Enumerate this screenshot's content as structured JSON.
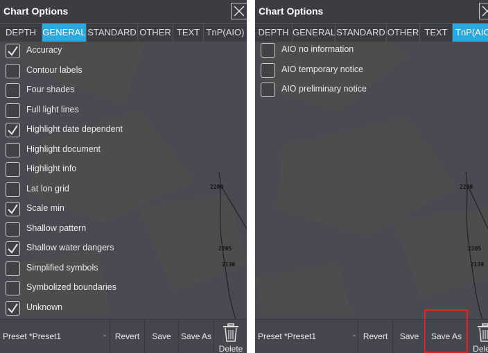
{
  "left_panel": {
    "title": "Chart Options",
    "tabs": [
      "DEPTH",
      "GENERAL",
      "STANDARD",
      "OTHER",
      "TEXT",
      "TnP(AIO)"
    ],
    "active_tab": "GENERAL",
    "items": [
      {
        "label": "Accuracy",
        "checked": true
      },
      {
        "label": "Contour labels",
        "checked": false
      },
      {
        "label": "Four shades",
        "checked": false
      },
      {
        "label": "Full light lines",
        "checked": false
      },
      {
        "label": "Highlight date dependent",
        "checked": true
      },
      {
        "label": "Highlight document",
        "checked": false
      },
      {
        "label": "Highlight info",
        "checked": false
      },
      {
        "label": "Lat lon grid",
        "checked": false
      },
      {
        "label": "Scale min",
        "checked": true
      },
      {
        "label": "Shallow pattern",
        "checked": false
      },
      {
        "label": "Shallow water dangers",
        "checked": true
      },
      {
        "label": "Simplified symbols",
        "checked": false
      },
      {
        "label": "Symbolized boundaries",
        "checked": false
      },
      {
        "label": "Unknown",
        "checked": true
      }
    ],
    "depths": [
      "2200",
      "2205",
      "2130"
    ],
    "preset_text": "Preset *Preset1",
    "preset_arrow": "-",
    "revert_label": "Revert",
    "save_label": "Save",
    "save_as_label": "Save As",
    "delete_label": "Delete"
  },
  "right_panel": {
    "title": "Chart Options",
    "tabs": [
      "DEPTH",
      "GENERAL",
      "STANDARD",
      "OTHER",
      "TEXT",
      "TnP(AIO"
    ],
    "active_tab": "TnP(AIO",
    "items": [
      {
        "label": "AIO no information",
        "checked": false
      },
      {
        "label": "AIO temporary notice",
        "checked": false
      },
      {
        "label": "AIO preliminary notice",
        "checked": false
      }
    ],
    "depths": [
      "2200",
      "2205",
      "2130"
    ],
    "preset_text": "Preset *Preset1",
    "preset_arrow": "-",
    "revert_label": "Revert",
    "save_label": "Save",
    "save_as_label": "Save As",
    "delete_label": "Delete"
  },
  "colors": {
    "accent": "#2aa9e0",
    "panel_bg": "#4a4b52",
    "highlight": "#e52222"
  }
}
